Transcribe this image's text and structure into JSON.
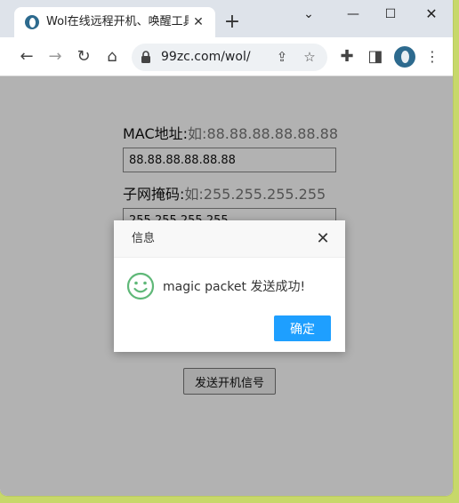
{
  "browser": {
    "tab_title": "Wol在线远程开机、唤醒工具",
    "tab_close": "✕",
    "new_tab": "+",
    "dropdown": "⌄",
    "minimize": "—",
    "maximize": "☐",
    "close": "✕",
    "url": "99zc.com/wol/"
  },
  "form": {
    "mac_label": "MAC地址:",
    "mac_hint": "如:88.88.88.88.88.88",
    "mac_value": "88.88.88.88.88.88",
    "mask_label": "子网掩码:",
    "mask_hint": "如:255.255.255.255",
    "mask_value": "255.255.255.255",
    "submit_label": "发送开机信号"
  },
  "dialog": {
    "title": "信息",
    "close": "✕",
    "message": "magic packet 发送成功!",
    "ok_label": "确定",
    "accent_color": "#1e9fff",
    "icon_color": "#5fb878"
  }
}
